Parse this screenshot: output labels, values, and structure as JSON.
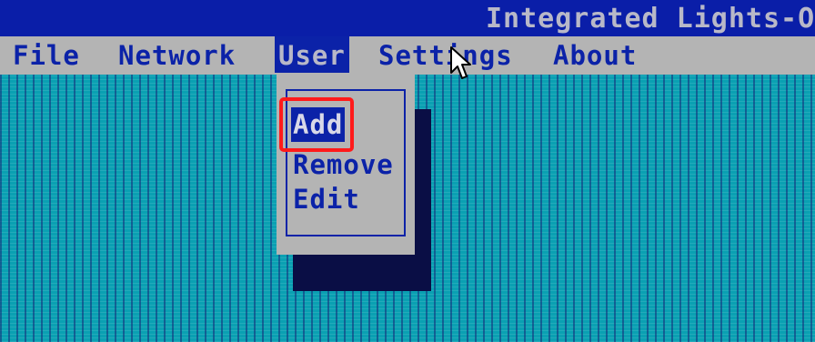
{
  "title_bar": {
    "title": "Integrated Lights-O"
  },
  "menu_bar": {
    "items": [
      {
        "label": "File"
      },
      {
        "label": "Network"
      },
      {
        "label": "User"
      },
      {
        "label": "Settings"
      },
      {
        "label": "About"
      }
    ],
    "selected": "User"
  },
  "user_menu": {
    "items": [
      {
        "label": "Add"
      },
      {
        "label": "Remove"
      },
      {
        "label": "Edit"
      }
    ],
    "selected": "Add"
  },
  "colors": {
    "title_bar_bg": "#0a1ea8",
    "menu_bg": "#b4b4b4",
    "menu_text": "#0b22a8",
    "desktop_bg": "#0aa0b2",
    "highlight": "#ff1a1a"
  },
  "icons": {
    "cursor": "mouse-pointer-icon"
  }
}
